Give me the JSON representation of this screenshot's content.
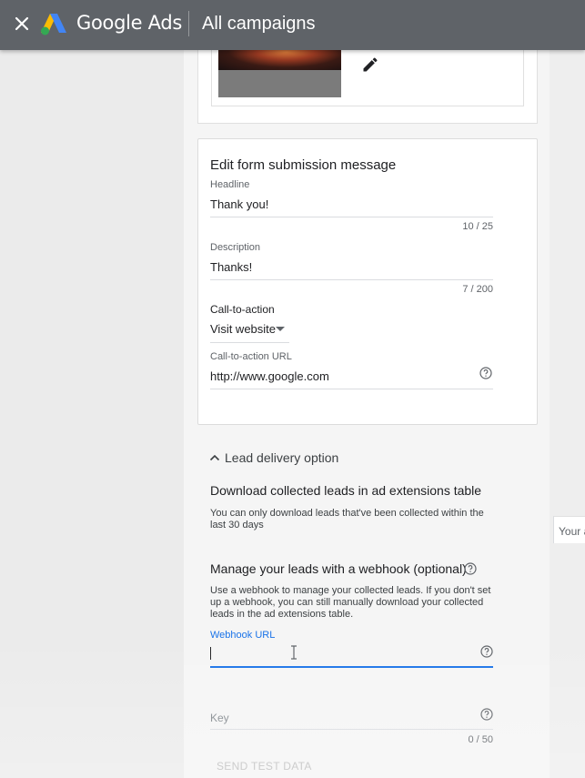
{
  "topbar": {
    "brand": "Google Ads",
    "title": "All campaigns",
    "close_icon": "close-icon",
    "logo_icon": "google-ads-logo",
    "bg_color": "#5f6368"
  },
  "image_card": {
    "edit_icon": "pencil-icon"
  },
  "form_message": {
    "title": "Edit form submission message",
    "headline_label": "Headline",
    "headline_value": "Thank you!",
    "headline_counter": "10 / 25",
    "description_label": "Description",
    "description_value": "Thanks!",
    "description_counter": "7 / 200",
    "cta_label": "Call-to-action",
    "cta_value": "Visit website",
    "cta_url_label": "Call-to-action URL",
    "cta_url_value": "http://www.google.com"
  },
  "lead_delivery": {
    "toggle_label": "Lead delivery option",
    "download_title": "Download collected leads in ad extensions table",
    "download_text": "You can only download leads that've been collected within the last 30 days",
    "webhook_title": "Manage your leads with a webhook (optional)",
    "webhook_text": "Use a webhook to manage your collected leads. If you don't set up a webhook, you can still manually download your collected leads in the ad extensions table.",
    "webhook_url_label": "Webhook URL",
    "webhook_url_value": "",
    "key_placeholder": "Key",
    "key_counter": "0 / 50",
    "send_test_label": "SEND TEST DATA"
  },
  "side_panel": {
    "peek_text": "Your a"
  },
  "colors": {
    "accent": "#1a73e8",
    "disabled": "#bdbdbd"
  }
}
